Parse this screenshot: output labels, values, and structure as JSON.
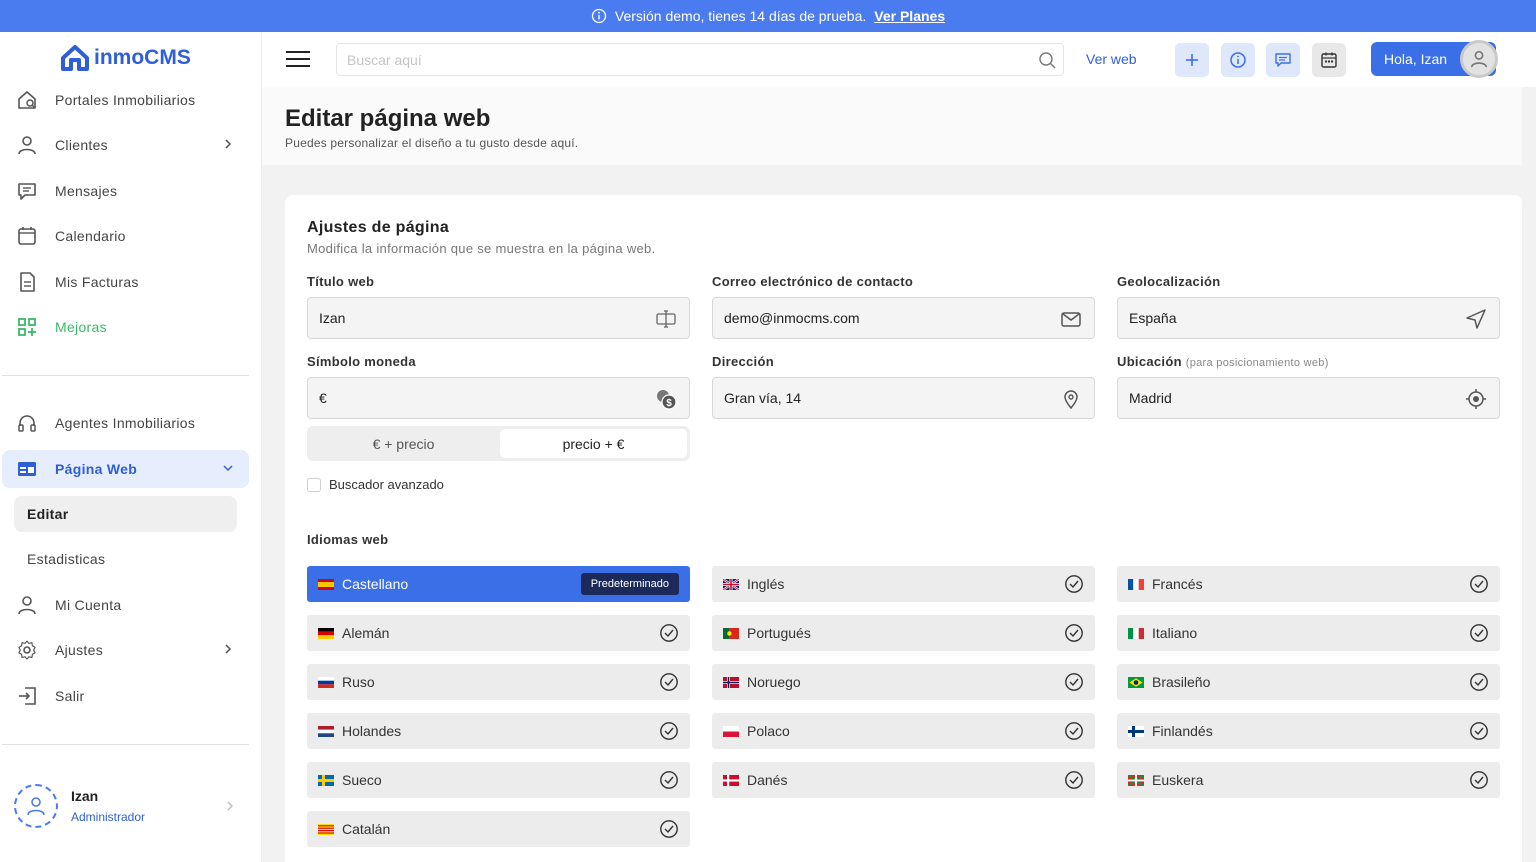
{
  "banner": {
    "text": "Versión demo, tienes 14 días de prueba.",
    "link": "Ver Planes"
  },
  "brand": {
    "name": "inmoCMS"
  },
  "sidebar": {
    "items": [
      {
        "label": "Portales Inmobiliarios"
      },
      {
        "label": "Clientes"
      },
      {
        "label": "Mensajes"
      },
      {
        "label": "Calendario"
      },
      {
        "label": "Mis Facturas"
      },
      {
        "label": "Mejoras"
      },
      {
        "label": "Agentes Inmobiliarios"
      },
      {
        "label": "Página Web"
      },
      {
        "label": "Mi Cuenta"
      },
      {
        "label": "Ajustes"
      },
      {
        "label": "Salir"
      }
    ],
    "sub": [
      {
        "label": "Editar"
      },
      {
        "label": "Estadisticas"
      }
    ],
    "user": {
      "name": "Izan",
      "role": "Administrador"
    }
  },
  "topbar": {
    "search_placeholder": "Buscar aquí",
    "ver_web": "Ver web",
    "greeting": "Hola, Izan"
  },
  "page": {
    "title": "Editar página web",
    "subtitle": "Puedes personalizar el diseño a tu gusto desde aquí."
  },
  "settings": {
    "title": "Ajustes de página",
    "subtitle": "Modifica la información que se muestra en la página web.",
    "fields": {
      "titulo": {
        "label": "Título web",
        "value": "Izan"
      },
      "correo": {
        "label": "Correo electrónico de contacto",
        "value": "demo@inmocms.com"
      },
      "geo": {
        "label": "Geolocalización",
        "value": "España"
      },
      "moneda": {
        "label": "Símbolo moneda",
        "value": "€"
      },
      "direccion": {
        "label": "Dirección",
        "value": "Gran vía, 14"
      },
      "ubicacion": {
        "label": "Ubicación",
        "hint": "(para posicionamiento web)",
        "value": "Madrid"
      }
    },
    "currency_format": {
      "options": [
        "€ + precio",
        "precio + €"
      ],
      "selected": "precio + €"
    },
    "buscador": {
      "label": "Buscador avanzado",
      "checked": false
    }
  },
  "languages": {
    "title": "Idiomas web",
    "default_badge": "Predeterminado",
    "items": [
      {
        "name": "Castellano",
        "default": true
      },
      {
        "name": "Inglés"
      },
      {
        "name": "Francés"
      },
      {
        "name": "Alemán"
      },
      {
        "name": "Portugués"
      },
      {
        "name": "Italiano"
      },
      {
        "name": "Ruso"
      },
      {
        "name": "Noruego"
      },
      {
        "name": "Brasileño"
      },
      {
        "name": "Holandes"
      },
      {
        "name": "Polaco"
      },
      {
        "name": "Finlandés"
      },
      {
        "name": "Sueco"
      },
      {
        "name": "Danés"
      },
      {
        "name": "Euskera"
      },
      {
        "name": "Catalán"
      }
    ]
  },
  "colors": {
    "accent": "#3a6fe8",
    "banner": "#4a7cf0",
    "green": "#3cb86b",
    "badge": "#1c2a5a"
  }
}
